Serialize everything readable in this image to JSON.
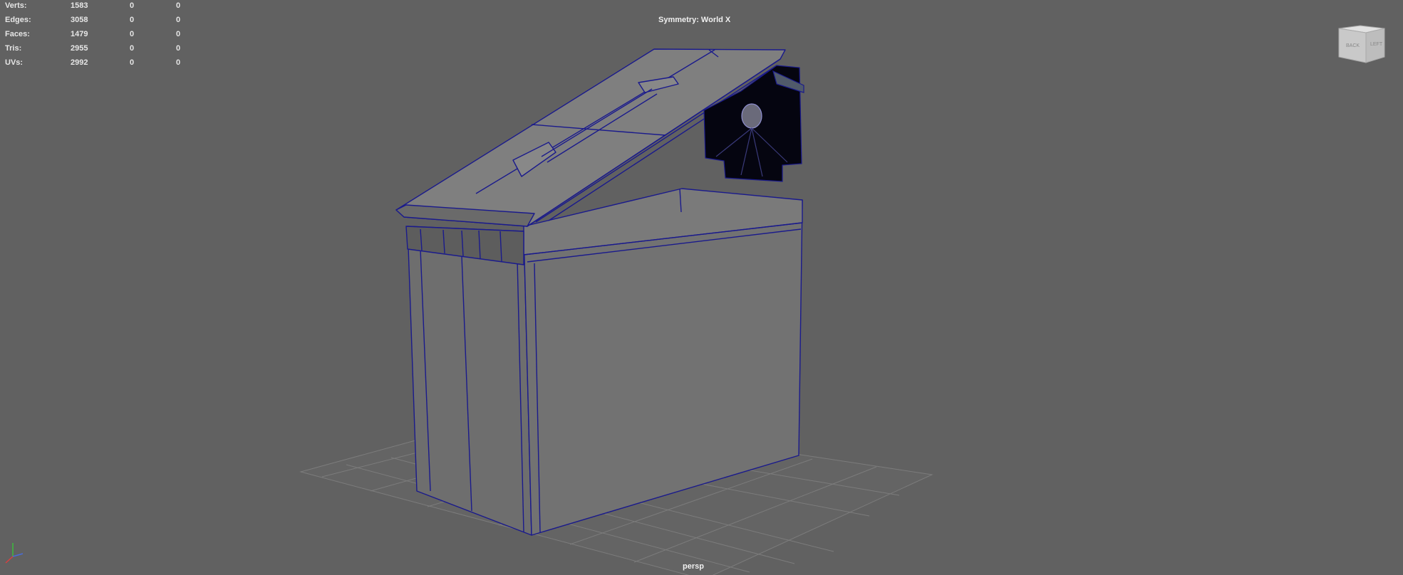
{
  "stats": [
    {
      "label": "Verts:",
      "v1": "1583",
      "v2": "0",
      "v3": "0"
    },
    {
      "label": "Edges:",
      "v1": "3058",
      "v2": "0",
      "v3": "0"
    },
    {
      "label": "Faces:",
      "v1": "1479",
      "v2": "0",
      "v3": "0"
    },
    {
      "label": "Tris:",
      "v1": "2955",
      "v2": "0",
      "v3": "0"
    },
    {
      "label": "UVs:",
      "v1": "2992",
      "v2": "0",
      "v3": "0"
    }
  ],
  "symmetry": "Symmetry: World X",
  "camera": "persp",
  "viewcube": {
    "back": "BACK",
    "left": "LEFT"
  },
  "colors": {
    "background": "#616161",
    "wireframe": "#1a1a8c",
    "grid": "#7a7a7a",
    "hud_text": "#e6e6e6"
  }
}
